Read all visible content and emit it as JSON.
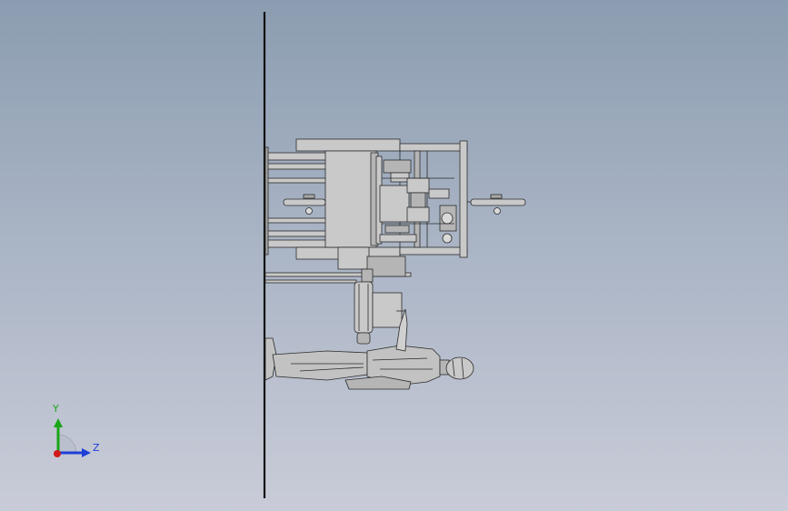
{
  "viewport": {
    "background_top": "#8c9db1",
    "background_bottom": "#c9ccd8"
  },
  "model": {
    "part_fill": "#c9c9c9",
    "part_dark": "#a9a9a9",
    "edge_color": "#2b2b2b"
  },
  "triad": {
    "y_label": "Y",
    "z_label": "Z",
    "y_color": "#1aa51a",
    "z_color": "#1f3fd6",
    "x_color": "#d21a1a",
    "label_color": "#1f3fd6"
  }
}
